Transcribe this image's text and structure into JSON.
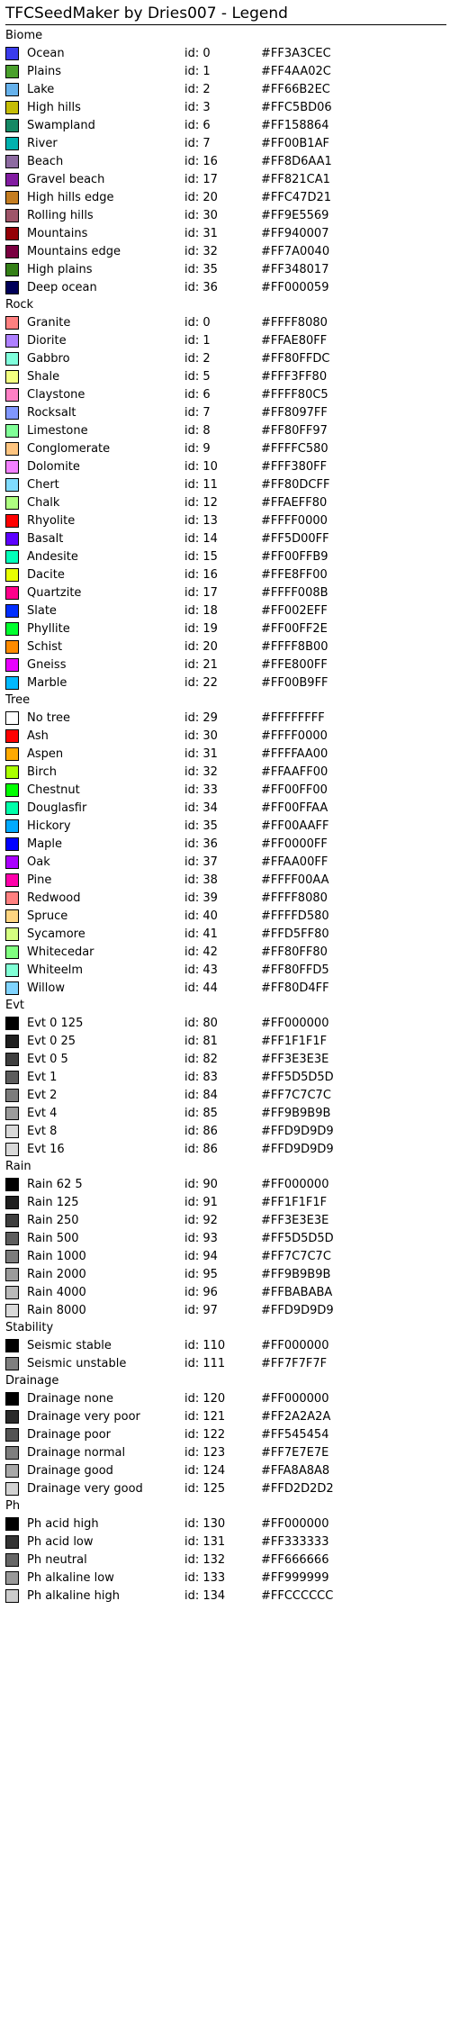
{
  "title": "TFCSeedMaker by Dries007 - Legend",
  "id_prefix": "id: ",
  "groups": [
    {
      "name": "Biome",
      "entries": [
        {
          "label": "Ocean",
          "id": "id: 0",
          "hex": "#FF3A3CEC",
          "color": "#3A3CEC"
        },
        {
          "label": "Plains",
          "id": "id: 1",
          "hex": "#FF4AA02C",
          "color": "#4AA02C"
        },
        {
          "label": "Lake",
          "id": "id: 2",
          "hex": "#FF66B2EC",
          "color": "#66B2EC"
        },
        {
          "label": "High hills",
          "id": "id: 3",
          "hex": "#FFC5BD06",
          "color": "#C5BD06"
        },
        {
          "label": "Swampland",
          "id": "id: 6",
          "hex": "#FF158864",
          "color": "#158864"
        },
        {
          "label": "River",
          "id": "id: 7",
          "hex": "#FF00B1AF",
          "color": "#00B1AF"
        },
        {
          "label": "Beach",
          "id": "id: 16",
          "hex": "#FF8D6AA1",
          "color": "#8D6AA1"
        },
        {
          "label": "Gravel beach",
          "id": "id: 17",
          "hex": "#FF821CA1",
          "color": "#821CA1"
        },
        {
          "label": "High hills edge",
          "id": "id: 20",
          "hex": "#FFC47D21",
          "color": "#C47D21"
        },
        {
          "label": "Rolling hills",
          "id": "id: 30",
          "hex": "#FF9E5569",
          "color": "#9E5569"
        },
        {
          "label": "Mountains",
          "id": "id: 31",
          "hex": "#FF940007",
          "color": "#940007"
        },
        {
          "label": "Mountains edge",
          "id": "id: 32",
          "hex": "#FF7A0040",
          "color": "#7A0040"
        },
        {
          "label": "High plains",
          "id": "id: 35",
          "hex": "#FF348017",
          "color": "#348017"
        },
        {
          "label": "Deep ocean",
          "id": "id: 36",
          "hex": "#FF000059",
          "color": "#000059"
        }
      ]
    },
    {
      "name": "Rock",
      "entries": [
        {
          "label": "Granite",
          "id": "id: 0",
          "hex": "#FFFF8080",
          "color": "#FF8080"
        },
        {
          "label": "Diorite",
          "id": "id: 1",
          "hex": "#FFAE80FF",
          "color": "#AE80FF"
        },
        {
          "label": "Gabbro",
          "id": "id: 2",
          "hex": "#FF80FFDC",
          "color": "#80FFDC"
        },
        {
          "label": "Shale",
          "id": "id: 5",
          "hex": "#FFF3FF80",
          "color": "#F3FF80"
        },
        {
          "label": "Claystone",
          "id": "id: 6",
          "hex": "#FFFF80C5",
          "color": "#FF80C5"
        },
        {
          "label": "Rocksalt",
          "id": "id: 7",
          "hex": "#FF8097FF",
          "color": "#8097FF"
        },
        {
          "label": "Limestone",
          "id": "id: 8",
          "hex": "#FF80FF97",
          "color": "#80FF97"
        },
        {
          "label": "Conglomerate",
          "id": "id: 9",
          "hex": "#FFFFC580",
          "color": "#FFC580"
        },
        {
          "label": "Dolomite",
          "id": "id: 10",
          "hex": "#FFF380FF",
          "color": "#F380FF"
        },
        {
          "label": "Chert",
          "id": "id: 11",
          "hex": "#FF80DCFF",
          "color": "#80DCFF"
        },
        {
          "label": "Chalk",
          "id": "id: 12",
          "hex": "#FFAEFF80",
          "color": "#AEFF80"
        },
        {
          "label": "Rhyolite",
          "id": "id: 13",
          "hex": "#FFFF0000",
          "color": "#FF0000"
        },
        {
          "label": "Basalt",
          "id": "id: 14",
          "hex": "#FF5D00FF",
          "color": "#5D00FF"
        },
        {
          "label": "Andesite",
          "id": "id: 15",
          "hex": "#FF00FFB9",
          "color": "#00FFB9"
        },
        {
          "label": "Dacite",
          "id": "id: 16",
          "hex": "#FFE8FF00",
          "color": "#E8FF00"
        },
        {
          "label": "Quartzite",
          "id": "id: 17",
          "hex": "#FFFF008B",
          "color": "#FF008B"
        },
        {
          "label": "Slate",
          "id": "id: 18",
          "hex": "#FF002EFF",
          "color": "#002EFF"
        },
        {
          "label": "Phyllite",
          "id": "id: 19",
          "hex": "#FF00FF2E",
          "color": "#00FF2E"
        },
        {
          "label": "Schist",
          "id": "id: 20",
          "hex": "#FFFF8B00",
          "color": "#FF8B00"
        },
        {
          "label": "Gneiss",
          "id": "id: 21",
          "hex": "#FFE800FF",
          "color": "#E800FF"
        },
        {
          "label": "Marble",
          "id": "id: 22",
          "hex": "#FF00B9FF",
          "color": "#00B9FF"
        }
      ]
    },
    {
      "name": "Tree",
      "entries": [
        {
          "label": "No tree",
          "id": "id: 29",
          "hex": "#FFFFFFFF",
          "color": "#FFFFFF"
        },
        {
          "label": "Ash",
          "id": "id: 30",
          "hex": "#FFFF0000",
          "color": "#FF0000"
        },
        {
          "label": "Aspen",
          "id": "id: 31",
          "hex": "#FFFFAA00",
          "color": "#FFAA00"
        },
        {
          "label": "Birch",
          "id": "id: 32",
          "hex": "#FFAAFF00",
          "color": "#AAFF00"
        },
        {
          "label": "Chestnut",
          "id": "id: 33",
          "hex": "#FF00FF00",
          "color": "#00FF00"
        },
        {
          "label": "Douglasfir",
          "id": "id: 34",
          "hex": "#FF00FFAA",
          "color": "#00FFAA"
        },
        {
          "label": "Hickory",
          "id": "id: 35",
          "hex": "#FF00AAFF",
          "color": "#00AAFF"
        },
        {
          "label": "Maple",
          "id": "id: 36",
          "hex": "#FF0000FF",
          "color": "#0000FF"
        },
        {
          "label": "Oak",
          "id": "id: 37",
          "hex": "#FFAA00FF",
          "color": "#AA00FF"
        },
        {
          "label": "Pine",
          "id": "id: 38",
          "hex": "#FFFF00AA",
          "color": "#FF00AA"
        },
        {
          "label": "Redwood",
          "id": "id: 39",
          "hex": "#FFFF8080",
          "color": "#FF8080"
        },
        {
          "label": "Spruce",
          "id": "id: 40",
          "hex": "#FFFFD580",
          "color": "#FFD580"
        },
        {
          "label": "Sycamore",
          "id": "id: 41",
          "hex": "#FFD5FF80",
          "color": "#D5FF80"
        },
        {
          "label": "Whitecedar",
          "id": "id: 42",
          "hex": "#FF80FF80",
          "color": "#80FF80"
        },
        {
          "label": "Whiteelm",
          "id": "id: 43",
          "hex": "#FF80FFD5",
          "color": "#80FFD5"
        },
        {
          "label": "Willow",
          "id": "id: 44",
          "hex": "#FF80D4FF",
          "color": "#80D4FF"
        }
      ]
    },
    {
      "name": "Evt",
      "entries": [
        {
          "label": "Evt 0 125",
          "id": "id: 80",
          "hex": "#FF000000",
          "color": "#000000"
        },
        {
          "label": "Evt 0 25",
          "id": "id: 81",
          "hex": "#FF1F1F1F",
          "color": "#1F1F1F"
        },
        {
          "label": "Evt 0 5",
          "id": "id: 82",
          "hex": "#FF3E3E3E",
          "color": "#3E3E3E"
        },
        {
          "label": "Evt 1",
          "id": "id: 83",
          "hex": "#FF5D5D5D",
          "color": "#5D5D5D"
        },
        {
          "label": "Evt 2",
          "id": "id: 84",
          "hex": "#FF7C7C7C",
          "color": "#7C7C7C"
        },
        {
          "label": "Evt 4",
          "id": "id: 85",
          "hex": "#FF9B9B9B",
          "color": "#9B9B9B"
        },
        {
          "label": "Evt 8",
          "id": "id: 86",
          "hex": "#FFD9D9D9",
          "color": "#D9D9D9"
        },
        {
          "label": "Evt 16",
          "id": "id: 86",
          "hex": "#FFD9D9D9",
          "color": "#D9D9D9"
        }
      ]
    },
    {
      "name": "Rain",
      "entries": [
        {
          "label": "Rain 62 5",
          "id": "id: 90",
          "hex": "#FF000000",
          "color": "#000000"
        },
        {
          "label": "Rain 125",
          "id": "id: 91",
          "hex": "#FF1F1F1F",
          "color": "#1F1F1F"
        },
        {
          "label": "Rain 250",
          "id": "id: 92",
          "hex": "#FF3E3E3E",
          "color": "#3E3E3E"
        },
        {
          "label": "Rain 500",
          "id": "id: 93",
          "hex": "#FF5D5D5D",
          "color": "#5D5D5D"
        },
        {
          "label": "Rain 1000",
          "id": "id: 94",
          "hex": "#FF7C7C7C",
          "color": "#7C7C7C"
        },
        {
          "label": "Rain 2000",
          "id": "id: 95",
          "hex": "#FF9B9B9B",
          "color": "#9B9B9B"
        },
        {
          "label": "Rain 4000",
          "id": "id: 96",
          "hex": "#FFBABABA",
          "color": "#BABABA"
        },
        {
          "label": "Rain 8000",
          "id": "id: 97",
          "hex": "#FFD9D9D9",
          "color": "#D9D9D9"
        }
      ]
    },
    {
      "name": "Stability",
      "entries": [
        {
          "label": "Seismic stable",
          "id": "id: 110",
          "hex": "#FF000000",
          "color": "#000000"
        },
        {
          "label": "Seismic unstable",
          "id": "id: 111",
          "hex": "#FF7F7F7F",
          "color": "#7F7F7F"
        }
      ]
    },
    {
      "name": "Drainage",
      "entries": [
        {
          "label": "Drainage none",
          "id": "id: 120",
          "hex": "#FF000000",
          "color": "#000000"
        },
        {
          "label": "Drainage very poor",
          "id": "id: 121",
          "hex": "#FF2A2A2A",
          "color": "#2A2A2A"
        },
        {
          "label": "Drainage poor",
          "id": "id: 122",
          "hex": "#FF545454",
          "color": "#545454"
        },
        {
          "label": "Drainage normal",
          "id": "id: 123",
          "hex": "#FF7E7E7E",
          "color": "#7E7E7E"
        },
        {
          "label": "Drainage good",
          "id": "id: 124",
          "hex": "#FFA8A8A8",
          "color": "#A8A8A8"
        },
        {
          "label": "Drainage very good",
          "id": "id: 125",
          "hex": "#FFD2D2D2",
          "color": "#D2D2D2"
        }
      ]
    },
    {
      "name": "Ph",
      "entries": [
        {
          "label": "Ph acid high",
          "id": "id: 130",
          "hex": "#FF000000",
          "color": "#000000"
        },
        {
          "label": "Ph acid low",
          "id": "id: 131",
          "hex": "#FF333333",
          "color": "#333333"
        },
        {
          "label": "Ph neutral",
          "id": "id: 132",
          "hex": "#FF666666",
          "color": "#666666"
        },
        {
          "label": "Ph alkaline low",
          "id": "id: 133",
          "hex": "#FF999999",
          "color": "#999999"
        },
        {
          "label": "Ph alkaline high",
          "id": "id: 134",
          "hex": "#FFCCCCCC",
          "color": "#CCCCCC"
        }
      ]
    }
  ]
}
